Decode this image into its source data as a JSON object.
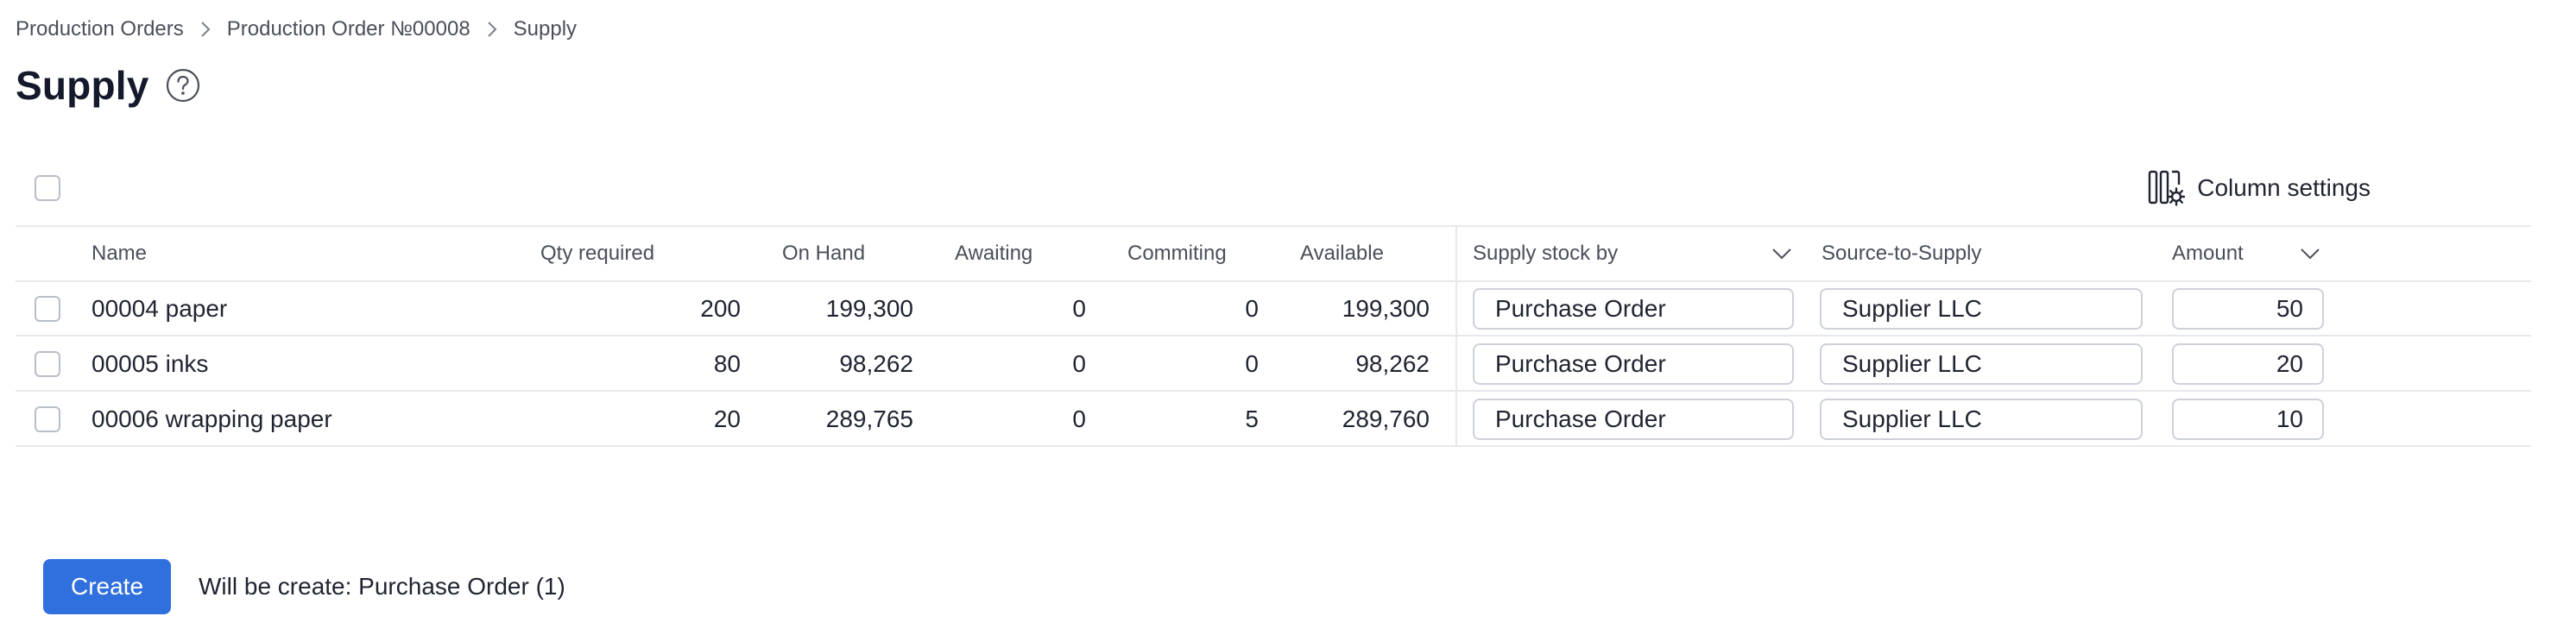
{
  "breadcrumb": {
    "items": [
      "Production Orders",
      "Production Order №00008",
      "Supply"
    ]
  },
  "page": {
    "title": "Supply"
  },
  "toolbar": {
    "column_settings_label": "Column settings"
  },
  "table": {
    "columns": {
      "name": "Name",
      "qty_required": "Qty required",
      "on_hand": "On Hand",
      "awaiting": "Awaiting",
      "commiting": "Commiting",
      "available": "Available",
      "supply_stock_by": "Supply stock by",
      "source_to_supply": "Source-to-Supply",
      "amount": "Amount"
    },
    "rows": [
      {
        "name": "00004 paper",
        "qty_required": "200",
        "on_hand": "199,300",
        "awaiting": "0",
        "commiting": "0",
        "available": "199,300",
        "supply_stock_by": "Purchase Order",
        "source_to_supply": "Supplier LLC",
        "amount": "50"
      },
      {
        "name": "00005 inks",
        "qty_required": "80",
        "on_hand": "98,262",
        "awaiting": "0",
        "commiting": "0",
        "available": "98,262",
        "supply_stock_by": "Purchase Order",
        "source_to_supply": "Supplier LLC",
        "amount": "20"
      },
      {
        "name": "00006 wrapping paper",
        "qty_required": "20",
        "on_hand": "289,765",
        "awaiting": "0",
        "commiting": "5",
        "available": "289,760",
        "supply_stock_by": "Purchase Order",
        "source_to_supply": "Supplier LLC",
        "amount": "10"
      }
    ]
  },
  "footer": {
    "create_label": "Create",
    "note": "Will be create: Purchase Order (1)"
  },
  "icons": {
    "help": "question-circle-icon",
    "breadcrumb_separator": "chevron-right-icon",
    "column_settings": "columns-gear-icon",
    "dropdown": "chevron-down-icon"
  },
  "colors": {
    "primary": "#2f6fde",
    "title": "#141a2b",
    "muted_text": "#4a4f59",
    "border": "#cdd1d8",
    "divider": "#e6e8ec"
  }
}
